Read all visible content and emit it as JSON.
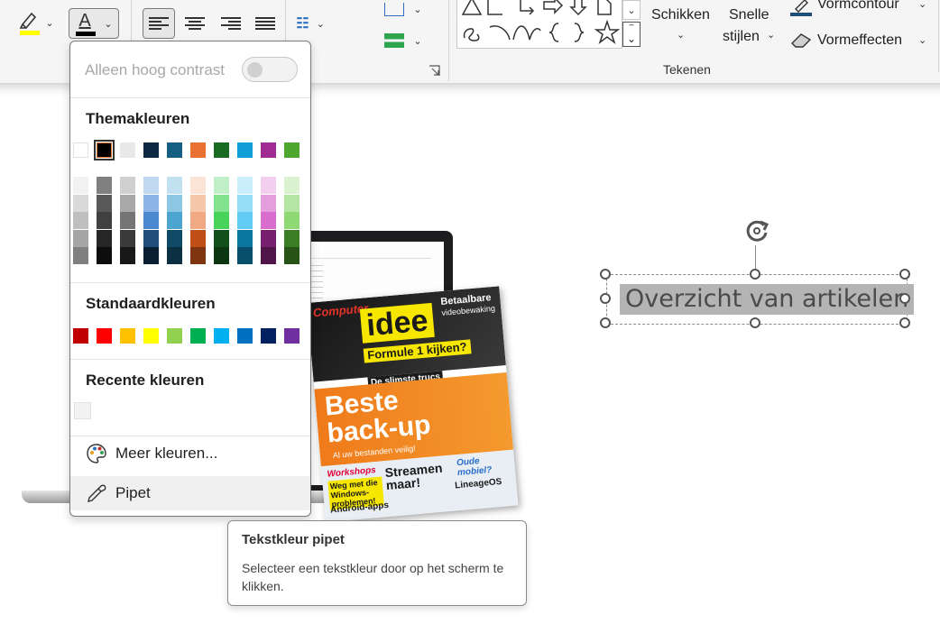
{
  "ribbon": {
    "arrange_label": "Schikken",
    "quick_styles_label_1": "Snelle",
    "quick_styles_label_2": "stijlen",
    "shape_outline_label": "Vormcontour",
    "shape_effects_label": "Vormeffecten",
    "drawing_group_label": "Tekenen",
    "highlight_color": "#ffff00",
    "font_color": "#000000"
  },
  "color_menu": {
    "high_contrast_label": "Alleen hoog contrast",
    "high_contrast_on": false,
    "theme_heading": "Themakleuren",
    "theme_colors": [
      "#ffffff",
      "#000000",
      "#e8e8e8",
      "#0e2841",
      "#156082",
      "#e97132",
      "#196b24",
      "#0f9ed5",
      "#a02b93",
      "#4ea72e"
    ],
    "theme_shades": [
      [
        "#f2f2f2",
        "#d9d9d9",
        "#bfbfbf",
        "#a6a6a6",
        "#808080"
      ],
      [
        "#808080",
        "#595959",
        "#404040",
        "#262626",
        "#0d0d0d"
      ],
      [
        "#d0d0d0",
        "#a9a9a9",
        "#757575",
        "#3a3a3a",
        "#181818"
      ],
      [
        "#c0d8f0",
        "#8ab4e6",
        "#4c88d0",
        "#1f4e79",
        "#0b1f33"
      ],
      [
        "#c2e1f0",
        "#8cc8e4",
        "#4ba5cf",
        "#0f4a66",
        "#0b3042"
      ],
      [
        "#fbe3d6",
        "#f7c7ac",
        "#f1a983",
        "#c04f15",
        "#7f3510"
      ],
      [
        "#c1f0c8",
        "#83e28e",
        "#47d359",
        "#124f1a",
        "#0c3512"
      ],
      [
        "#caeefb",
        "#95dcf7",
        "#61cbf3",
        "#0b769f",
        "#074f6a"
      ],
      [
        "#f2cfee",
        "#e59edc",
        "#d86dcd",
        "#782070",
        "#501549"
      ],
      [
        "#daf2d0",
        "#b4e5a2",
        "#8ed973",
        "#3b7d23",
        "#275317"
      ]
    ],
    "standard_heading": "Standaardkleuren",
    "standard_colors": [
      "#c00000",
      "#ff0000",
      "#ffc000",
      "#ffff00",
      "#92d050",
      "#00b050",
      "#00b0f0",
      "#0070c0",
      "#002060",
      "#7030a0"
    ],
    "recent_heading": "Recente kleuren",
    "recent_colors": [
      "#f2f2f2"
    ],
    "more_colors_label": "Meer kleuren...",
    "eyedropper_label": "Pipet",
    "selected_theme_index": 1
  },
  "tooltip": {
    "title": "Tekstkleur pipet",
    "body": "Selecteer een tekstkleur door op het scherm te klikken."
  },
  "slide": {
    "title_text": "Overzicht van artikelen",
    "magazine": {
      "brand": "Computer",
      "name": "idee",
      "side_1": "Betaalbare",
      "side_2": "videobewaking",
      "formula": "Formule 1 kijken?",
      "slimste": "De slimste trucs",
      "cover_1": "Beste",
      "cover_2": "back-up",
      "bestanden": "Al uw bestanden veilig!",
      "workshops": "Workshops",
      "windows": "Weg met die Windows-problemen!",
      "streamen": "Streamen maar!",
      "oude": "Oude mobiel?",
      "lineage": "LineageOS",
      "android": "Android-apps"
    }
  }
}
